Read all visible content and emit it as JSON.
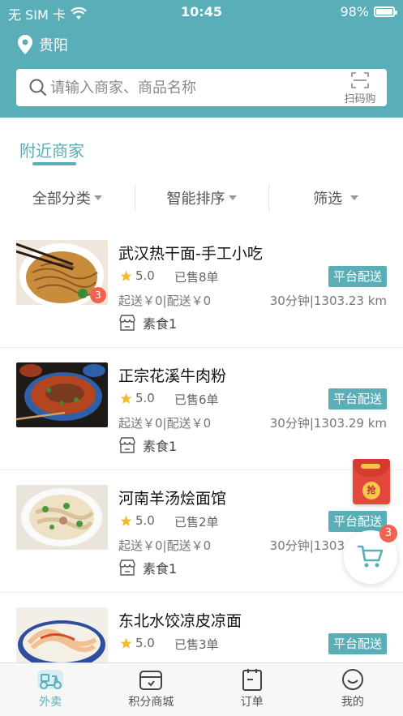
{
  "status_bar": {
    "carrier": "无 SIM 卡",
    "time": "10:45",
    "battery": "98%",
    "battery_level": 0.98
  },
  "location": {
    "city": "贵阳"
  },
  "search": {
    "placeholder": "请输入商家、商品名称",
    "scan_label": "扫码购"
  },
  "section": {
    "title": "附近商家"
  },
  "filters": [
    "全部分类",
    "智能排序",
    "筛选"
  ],
  "merchants": [
    {
      "name": "武汉热干面-手工小吃",
      "rating": "5.0",
      "sold": "已售8单",
      "tag": "平台配送",
      "fees": "起送￥0|配送￥0",
      "distance": "30分钟|1303.23 km",
      "category": "素食1",
      "badge": "3"
    },
    {
      "name": "正宗花溪牛肉粉",
      "rating": "5.0",
      "sold": "已售6单",
      "tag": "平台配送",
      "fees": "起送￥0|配送￥0",
      "distance": "30分钟|1303.29 km",
      "category": "素食1"
    },
    {
      "name": "河南羊汤烩面馆",
      "rating": "5.0",
      "sold": "已售2单",
      "tag": "平台配送",
      "fees": "起送￥0|配送￥0",
      "distance": "30分钟|1303",
      "category": "素食1"
    },
    {
      "name": "东北水饺凉皮凉面",
      "rating": "5.0",
      "sold": "已售3单",
      "tag": "平台配送"
    }
  ],
  "floating": {
    "redpacket_label": "抢",
    "cart_badge": "3"
  },
  "tabbar": {
    "items": [
      "外卖",
      "积分商城",
      "订单",
      "我的"
    ]
  },
  "colors": {
    "accent": "#5aaeb8",
    "badge": "#f06350",
    "star": "#f5b731"
  }
}
